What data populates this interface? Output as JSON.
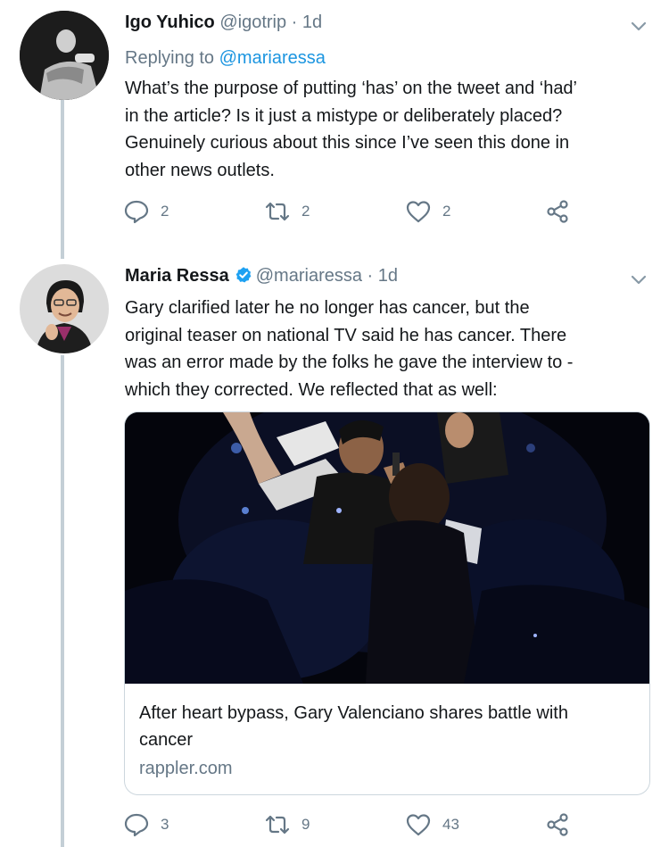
{
  "tweets": [
    {
      "display_name": "Igo Yuhico",
      "handle": "@igotrip",
      "separator": "·",
      "time": "1d",
      "replying_prefix": "Replying to",
      "replying_to": "@mariaressa",
      "text_lines": [
        "What’s the purpose of putting ‘has’ on the tweet and ‘had’",
        "in the article? Is it just a mistype or deliberately placed?",
        "Genuinely curious about this since I’ve seen this done in",
        "other news outlets."
      ],
      "reply_count": "2",
      "retweet_count": "2",
      "like_count": "2"
    },
    {
      "display_name": "Maria Ressa",
      "verified": true,
      "handle": "@mariaressa",
      "separator": "·",
      "time": "1d",
      "text_lines": [
        "Gary clarified later he no longer has cancer, but the",
        "original teaser on national TV said he has cancer. There",
        "was an error made by the folks he gave the interview to -",
        "which they corrected. We reflected that as well:"
      ],
      "card": {
        "title_lines": [
          "After heart bypass, Gary Valenciano shares battle with",
          "cancer"
        ],
        "domain": "rappler.com"
      },
      "reply_count": "3",
      "retweet_count": "9",
      "like_count": "43"
    }
  ],
  "icons": {
    "avatar_1": "person-photo-avatar",
    "avatar_2": "person-photo-avatar",
    "more": "chevron-down-icon",
    "reply": "speech-bubble-icon",
    "retweet": "retweet-arrows-icon",
    "like": "heart-icon",
    "share": "share-nodes-icon",
    "verified": "verified-badge-icon"
  },
  "colors": {
    "text": "#14171a",
    "secondary": "#657786",
    "link": "#1b95e0",
    "verified": "#1da1f2",
    "thread_line": "#c4cfd6"
  }
}
